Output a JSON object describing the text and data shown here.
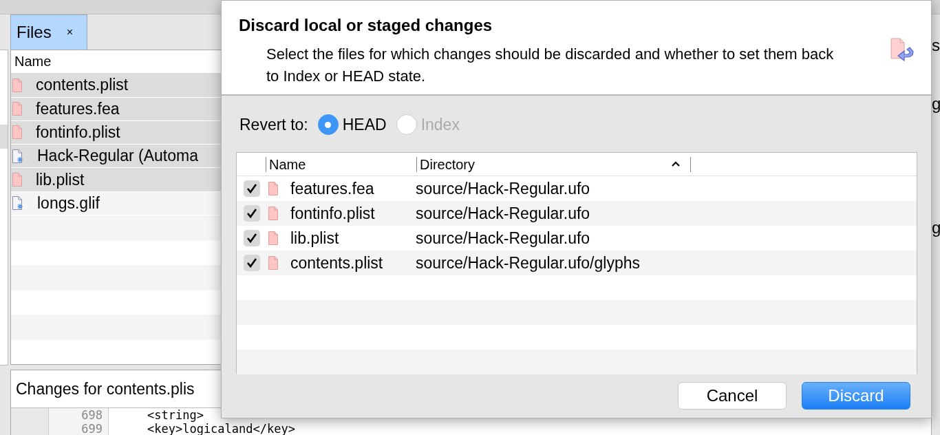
{
  "background": {
    "tab": {
      "label": "Files",
      "close": "×",
      "selected": true
    },
    "files": {
      "column": "Name",
      "rows": [
        {
          "name": "contents.plist",
          "kind": "changed",
          "selected": true
        },
        {
          "name": "features.fea",
          "kind": "changed",
          "selected": true
        },
        {
          "name": "fontinfo.plist",
          "kind": "changed",
          "selected": true
        },
        {
          "name": "Hack-Regular (Automa",
          "kind": "generated",
          "selected": true
        },
        {
          "name": "lib.plist",
          "kind": "changed",
          "selected": true
        },
        {
          "name": "longs.glif",
          "kind": "generated",
          "selected": false
        }
      ]
    },
    "right_fragments": [
      "s",
      "g",
      "g"
    ],
    "changes": {
      "title": "Changes for contents.plis",
      "lines": [
        {
          "number": "698",
          "code": "<string>"
        },
        {
          "number": "699",
          "code": "<key>logicaland</key>"
        }
      ]
    }
  },
  "dialog": {
    "title": "Discard local or staged changes",
    "description": "Select the files for which changes should be discarded and whether to set them back to Index or HEAD state.",
    "revert": {
      "label": "Revert to:",
      "options": [
        {
          "label": "HEAD",
          "selected": true,
          "disabled": false
        },
        {
          "label": "Index",
          "selected": false,
          "disabled": true
        }
      ]
    },
    "table": {
      "columns": [
        "Name",
        "Directory"
      ],
      "rows": [
        {
          "checked": true,
          "name": "features.fea",
          "directory": "source/Hack-Regular.ufo"
        },
        {
          "checked": true,
          "name": "fontinfo.plist",
          "directory": "source/Hack-Regular.ufo"
        },
        {
          "checked": true,
          "name": "lib.plist",
          "directory": "source/Hack-Regular.ufo"
        },
        {
          "checked": true,
          "name": "contents.plist",
          "directory": "source/Hack-Regular.ufo/glyphs"
        }
      ]
    },
    "buttons": [
      {
        "label": "Cancel",
        "kind": "secondary"
      },
      {
        "label": "Discard",
        "kind": "primary"
      }
    ]
  }
}
